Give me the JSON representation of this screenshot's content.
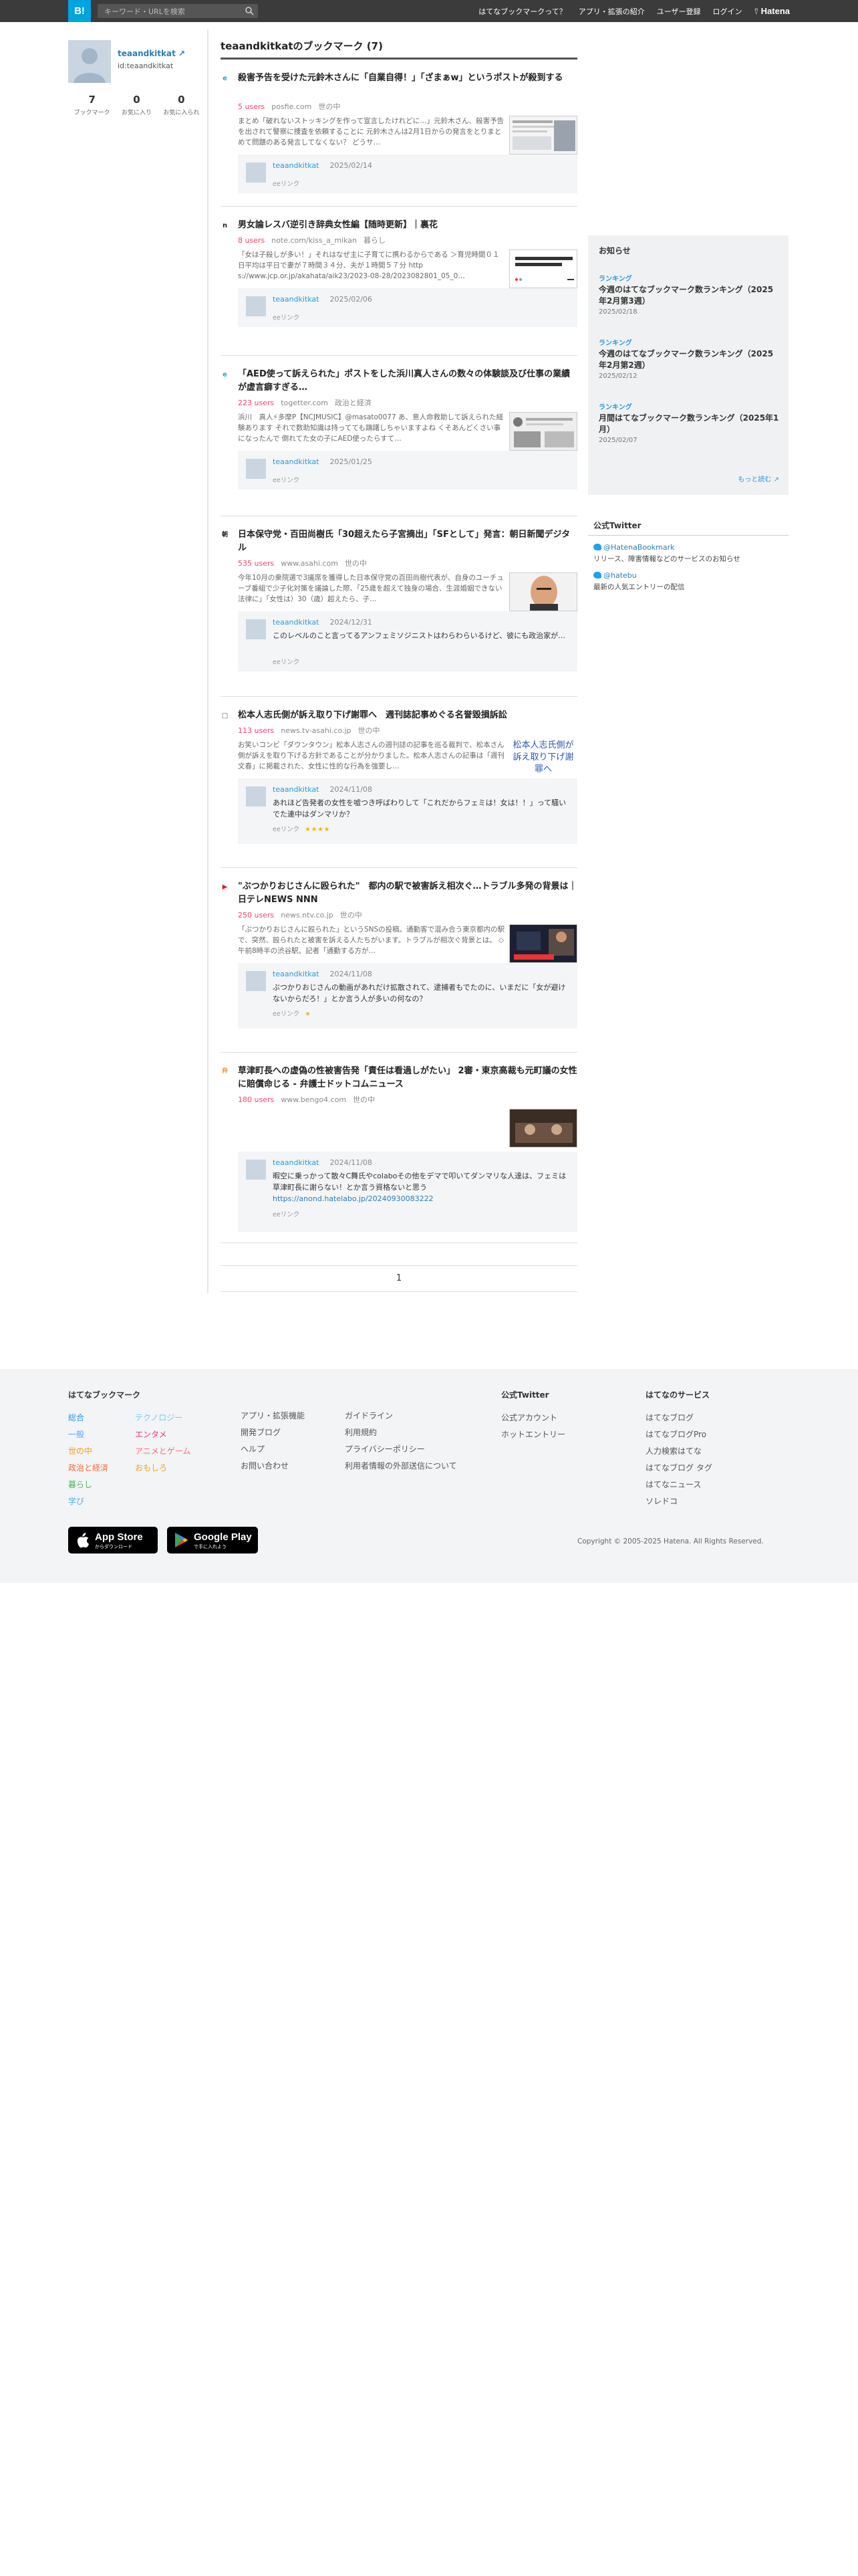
{
  "header": {
    "logo": "B!",
    "search_placeholder": "キーワード・URLを検索",
    "nav": [
      "はてなブックマークって？",
      "アプリ・拡張の紹介",
      "ユーザー登録",
      "ログイン"
    ],
    "brand": "Hatena"
  },
  "profile": {
    "name": "teaandkitkat",
    "id": "id:teaandkitkat",
    "stats": [
      {
        "n": "7",
        "label": "ブックマーク"
      },
      {
        "n": "0",
        "label": "お気に入り"
      },
      {
        "n": "0",
        "label": "お気に入られ"
      }
    ]
  },
  "main": {
    "title": "teaandkitkatのブックマーク (7)",
    "entries": [
      {
        "favicon": "e",
        "title": "殺害予告を受けた元鈴木さんに「自業自得！」「ざまぁw」というポストが殺到する",
        "users": "5 users",
        "site": "posfie.com",
        "category": "世の中",
        "summary": "まとめ「破れないストッキングを作って宣言したけれどに…」元鈴木さん、殺害予告を出されて警察に捜査を依頼することに 元鈴木さんは2月1日からの発言をとりまとめて問題のある発言してなくない？ どうサ…",
        "user": "teaandkitkat",
        "date": "2025/02/14",
        "comment": "",
        "link": "",
        "relink": "eeリンク",
        "stars": ""
      },
      {
        "favicon": "n",
        "title": "男女論レスバ逆引き辞典女性編【随時更新】｜裏花",
        "users": "8 users",
        "site": "note.com/kiss_a_mikan",
        "category": "暮らし",
        "summary": "「女は子殺しが多い！」それはなぜ主に子育てに携わるからである ＞育児時間０１日平均は平日で妻が７時間３４分、夫が１時間５７分 http s://www.jcp.or.jp/akahata/aik23/2023-08-28/2023082801_05_0…",
        "user": "teaandkitkat",
        "date": "2025/02/06",
        "comment": "",
        "link": "",
        "relink": "eeリンク",
        "stars": ""
      },
      {
        "favicon": "e",
        "title": "「AED使って訴えられた」ポストをした浜川真人さんの数々の体験談及び仕事の業績が虚言癖すぎる…",
        "users": "223 users",
        "site": "togetter.com",
        "category": "政治と経済",
        "summary": "浜川　真人⚡多摩P【NCJMUSIC】@masato0077 あ、意人命救助して訴えられた経験あります それで数助知識は持ってても躊躇しちゃいますよね くそあんどくさい事になったんで 倒れてた女の子にAED使ったらすて…",
        "user": "teaandkitkat",
        "date": "2025/01/25",
        "comment": "",
        "link": "",
        "relink": "eeリンク",
        "stars": ""
      },
      {
        "favicon": "朝",
        "title": "日本保守党・百田尚樹氏「30超えたら子宮摘出」「SFとして」発言：朝日新聞デジタル",
        "users": "535 users",
        "site": "www.asahi.com",
        "category": "世の中",
        "summary": "今年10月の衆院選で3議席を獲得した日本保守党の百田尚樹代表が、自身のユーチューブ番組で少子化対策を議論した際、「25歳を超えて独身の場合、生涯婚姻できない法律に」「女性は）30（歳）超えたら、子…",
        "user": "teaandkitkat",
        "date": "2024/12/31",
        "comment": "このレベルのこと言ってるアンフェミソジニストはわらわらいるけど、彼にも政治家が…",
        "link": "",
        "relink": "eeリンク",
        "stars": ""
      },
      {
        "favicon": "□",
        "title": "松本人志氏側が訴え取り下げ謝罪へ　週刊誌記事めぐる名誉毀損訴訟",
        "users": "113 users",
        "site": "news.tv-asahi.co.jp",
        "category": "世の中",
        "summary": "お笑いコンビ「ダウンタウン」松本人志さんの週刊誌の記事を巡る裁判で、松本さん側が訴えを取り下げる方針であることが分かりました。松本人志さんの記事は「週刊文春」に掲載された、女性に性的な行為を強要し…",
        "user": "teaandkitkat",
        "date": "2024/11/08",
        "comment": "あれほど告発者の女性を嘘つき呼ばわりして「これだからフェミは！女は！！」って騒いでた連中はダンマリか？",
        "link": "",
        "relink": "eeリンク",
        "stars": "★★★★",
        "thumb_alt": "松本人志氏側が訴え取り下げ謝罪へ"
      },
      {
        "favicon": "▶",
        "title": "\"ぶつかりおじさんに殴られた\"　都内の駅で被害訴え相次ぐ…トラブル多発の背景は｜日テレNEWS NNN",
        "users": "250 users",
        "site": "news.ntv.co.jp",
        "category": "世の中",
        "summary": "「ぶつかりおじさんに殴られた」というSNSの投稿。通勤客で混み合う東京都内の駅で、突然、殴られたと被害を訴える人たちがいます。トラブルが相次ぐ背景とは。 ◇午前8時半の渋谷駅。記者「通勤する方が…",
        "user": "teaandkitkat",
        "date": "2024/11/08",
        "comment": "ぶつかりおじさんの動画があれだけ拡散されて、逮捕者もでたのに、いまだに「女が避けないからだろ！」とか言う人が多いの何なの？",
        "link": "",
        "relink": "eeリンク",
        "stars": "★"
      },
      {
        "favicon": "弁",
        "title": "草津町長への虚偽の性被害告発「責任は看過しがたい」 2審・東京高裁も元町議の女性に賠償命じる - 弁護士ドットコムニュース",
        "users": "180 users",
        "site": "www.bengo4.com",
        "category": "世の中",
        "summary": "",
        "user": "teaandkitkat",
        "date": "2024/11/08",
        "comment": "暇空に乗っかって散々C舞氏やcolaboその他をデマで叩いてダンマリな人達は、フェミは草津町長に謝らない！とか言う資格ないと思う",
        "link": "https://anond.hatelabo.jp/20240930083222",
        "relink": "eeリンク",
        "stars": ""
      }
    ],
    "pager": "1"
  },
  "sidebar": {
    "notice_title": "お知らせ",
    "notices": [
      {
        "category": "ランキング",
        "title": "今週のはてなブックマーク数ランキング（2025年2月第3週）",
        "date": "2025/02/18"
      },
      {
        "category": "ランキング",
        "title": "今週のはてなブックマーク数ランキング（2025年2月第2週）",
        "date": "2025/02/12"
      },
      {
        "category": "ランキング",
        "title": "月間はてなブックマーク数ランキング（2025年1月）",
        "date": "2025/02/07"
      }
    ],
    "more": "もっと読む",
    "twitter_title": "公式Twitter",
    "twitter": [
      {
        "account": "@HatenaBookmark",
        "desc": "リリース、障害情報などのサービスのお知らせ"
      },
      {
        "account": "@hatebu",
        "desc": "最新の人気エントリーの配信"
      }
    ]
  },
  "footer": {
    "col1_title": "はてなブックマーク",
    "col1a": [
      "総合",
      "一般",
      "世の中",
      "政治と経済",
      "暮らし",
      "学び"
    ],
    "col1b": [
      "テクノロジー",
      "エンタメ",
      "アニメとゲーム",
      "おもしろ"
    ],
    "col2": [
      "アプリ・拡張機能",
      "開発ブログ",
      "ヘルプ",
      "お問い合わせ"
    ],
    "col3": [
      "ガイドライン",
      "利用規約",
      "プライバシーポリシー",
      "利用者情報の外部送信について"
    ],
    "col4_title": "公式Twitter",
    "col4": [
      "公式アカウント",
      "ホットエントリー"
    ],
    "col5_title": "はてなのサービス",
    "col5": [
      "はてなブログ",
      "はてなブログPro",
      "人力検索はてな",
      "はてなブログ タグ",
      "はてなニュース",
      "ソレドコ"
    ],
    "appstore_top": "Download on the",
    "appstore": "App Store",
    "appstore_sub": "からダウンロード",
    "googleplay": "Google Play",
    "googleplay_sub": "で手に入れよう",
    "copyright": "Copyright © 2005-2025 Hatena. All Rights Reserved."
  }
}
